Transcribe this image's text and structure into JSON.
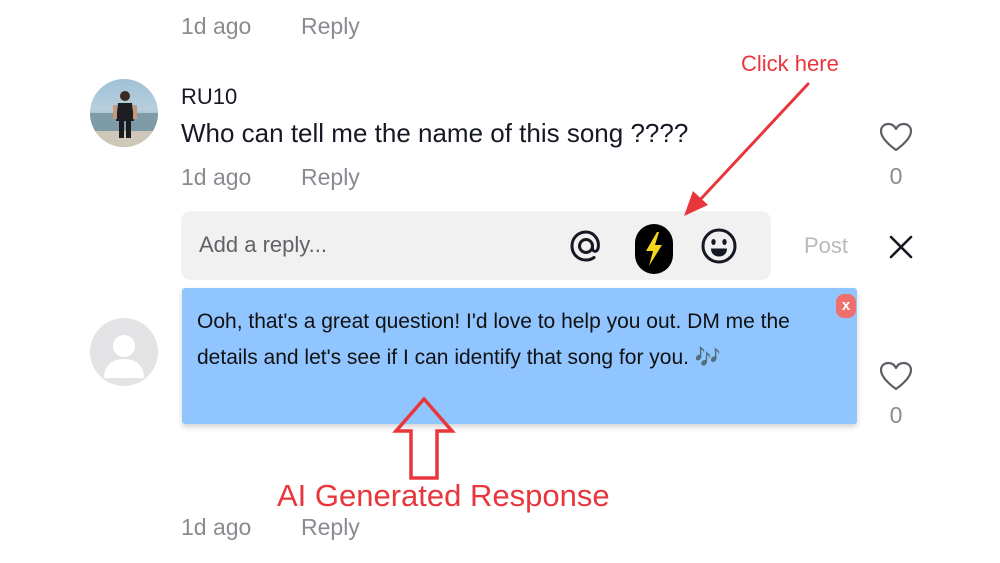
{
  "previous_comment": {
    "time": "1d ago",
    "reply_label": "Reply"
  },
  "main_comment": {
    "username": "RU10",
    "text": "Who can tell me the name of this song ????",
    "time": "1d ago",
    "reply_label": "Reply",
    "like_count": "0"
  },
  "reply_composer": {
    "placeholder": "Add a reply...",
    "mention_icon": "at-icon",
    "ai_icon": "lightning-icon",
    "emoji_icon": "emoji-icon",
    "post_label": "Post",
    "close_icon": "close-icon"
  },
  "ai_suggestion": {
    "text": "Ooh, that's a great question! I'd love to help you out. DM me the details and let's see if I can identify that song for you. 🎶",
    "close_label": "x"
  },
  "second_comment": {
    "like_count": "0"
  },
  "bottom_comment": {
    "time": "1d ago",
    "reply_label": "Reply"
  },
  "annotations": {
    "click_here": "Click here",
    "ai_generated": "AI Generated Response"
  },
  "colors": {
    "annotation_red": "#e8363c",
    "ai_box_blue": "#90c5ff",
    "ai_button_yellow": "#f7d51c",
    "muted_text": "#8a8b91"
  }
}
